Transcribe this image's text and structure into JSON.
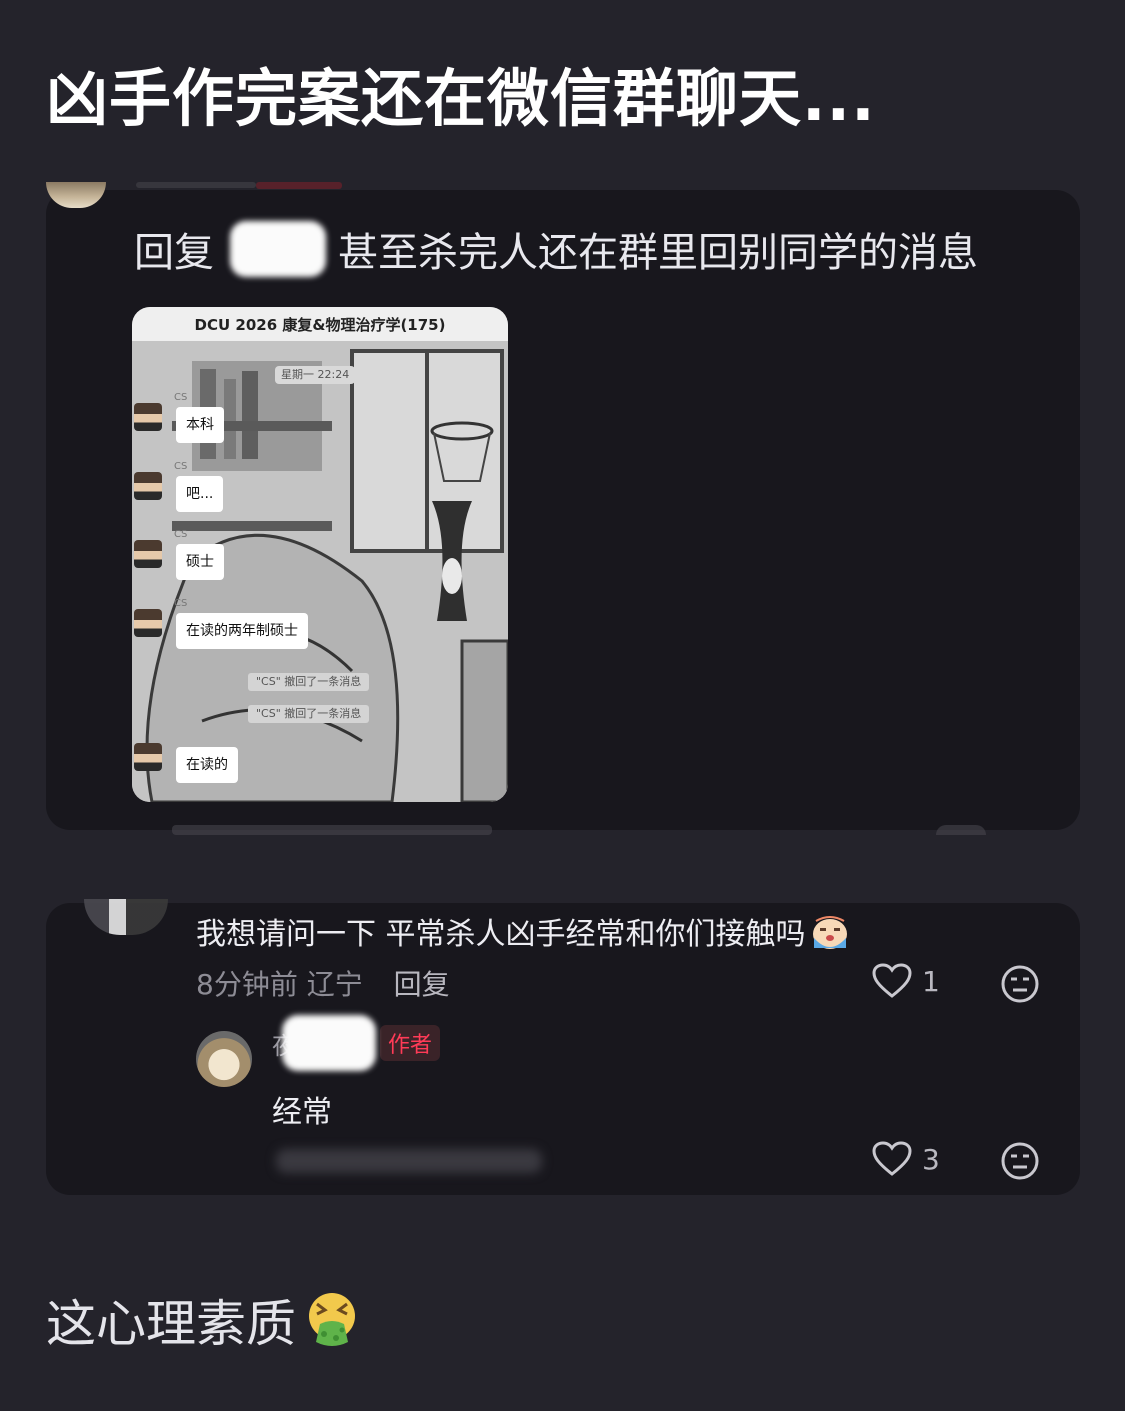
{
  "headline": "凶手作完案还在微信群聊天...",
  "post": {
    "reply_prefix": "回复",
    "reply_text": "甚至杀完人还在群里回别同学的消息",
    "screenshot": {
      "group_title": "DCU 2026 康复&物理治疗学(175)",
      "timestamp": "星期一 22:24",
      "sender": "CS",
      "messages": [
        "本科",
        "吧...",
        "硕士",
        "在读的两年制硕士",
        "在读的"
      ],
      "system_notices": [
        "\"CS\" 撤回了一条消息",
        "\"CS\" 撤回了一条消息"
      ]
    }
  },
  "comment": {
    "text": "我想请问一下 平常杀人凶手经常和你们接触吗",
    "time": "8分钟前",
    "location": "辽宁",
    "reply_label": "回复",
    "likes": "1",
    "reply": {
      "name_visible_char": "夜",
      "author_tag": "作者",
      "text": "经常",
      "likes": "3"
    }
  },
  "footer": "这心理素质",
  "icons": {
    "like": "heart-icon",
    "dislike": "meh-face-icon",
    "emoji_reply": "crying-emoji-icon",
    "emoji_footer": "vomiting-face-emoji"
  },
  "colors": {
    "background": "#24232b",
    "card": "#18171d",
    "author_tag": "#ff3b57"
  }
}
